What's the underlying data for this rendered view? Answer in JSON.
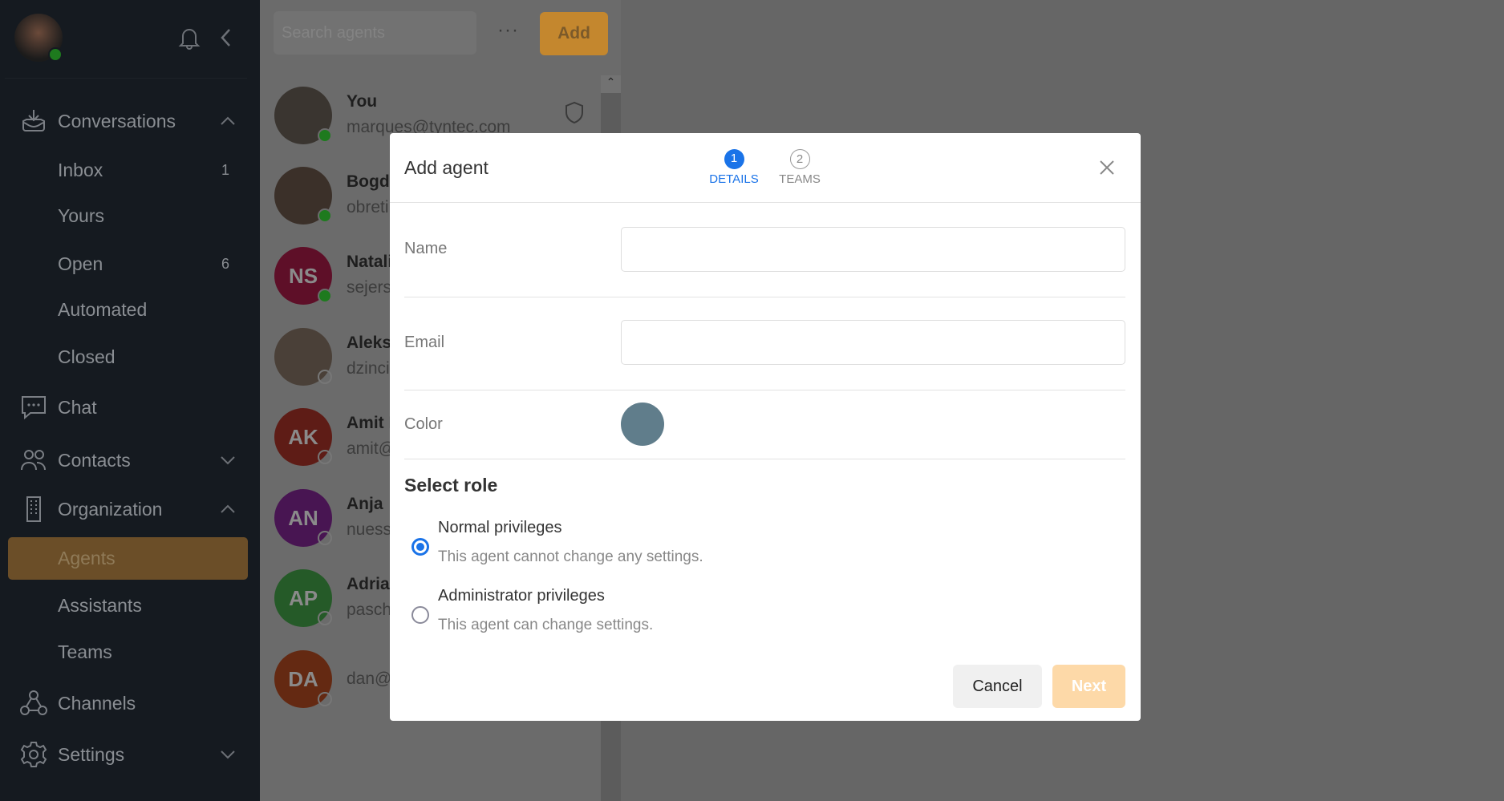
{
  "sidebar": {
    "items": [
      {
        "label": "Conversations",
        "icon": "inbox-download-icon",
        "chevron": "up"
      },
      {
        "label": "Inbox",
        "count": "1"
      },
      {
        "label": "Yours"
      },
      {
        "label": "Open",
        "count": "6"
      },
      {
        "label": "Automated"
      },
      {
        "label": "Closed"
      },
      {
        "label": "Chat",
        "icon": "chat-bubble-icon"
      },
      {
        "label": "Contacts",
        "icon": "people-icon",
        "chevron": "down"
      },
      {
        "label": "Organization",
        "icon": "building-icon",
        "chevron": "up"
      },
      {
        "label": "Agents",
        "active": true
      },
      {
        "label": "Assistants"
      },
      {
        "label": "Teams"
      },
      {
        "label": "Channels",
        "icon": "channels-icon"
      },
      {
        "label": "Settings",
        "icon": "gear-icon",
        "chevron": "down"
      }
    ]
  },
  "agents_panel": {
    "search_placeholder": "Search agents",
    "more_label": "···",
    "add_label": "Add",
    "rows": [
      {
        "name": "You",
        "email": "marques@tyntec.com",
        "initials": "",
        "color": "#3a3530",
        "online": true
      },
      {
        "name": "Bogda",
        "email": "obreti",
        "initials": "",
        "color": "#3b3029",
        "online": true
      },
      {
        "name": "Natali",
        "email": "sejers",
        "initials": "NS",
        "color": "#5e0f28",
        "online": true
      },
      {
        "name": "Aleks",
        "email": "dzinci",
        "initials": "",
        "color": "#4a4038",
        "online": false
      },
      {
        "name": "Amit I",
        "email": "amit@",
        "initials": "AK",
        "color": "#5e1c16",
        "online": false
      },
      {
        "name": "Anja",
        "email": "nuess",
        "initials": "AN",
        "color": "#481552",
        "online": false
      },
      {
        "name": "Adrian",
        "email": "pasch",
        "initials": "AP",
        "color": "#255a28",
        "online": false
      },
      {
        "name": "",
        "email": "dan@",
        "initials": "DA",
        "color": "#642912",
        "online": false
      }
    ]
  },
  "modal": {
    "title": "Add agent",
    "steps": [
      {
        "num": "1",
        "label": "DETAILS",
        "active": true
      },
      {
        "num": "2",
        "label": "TEAMS",
        "active": false
      }
    ],
    "name_label": "Name",
    "name_value": "",
    "email_label": "Email",
    "email_value": "",
    "color_label": "Color",
    "color_value": "#607d8b",
    "role_heading": "Select role",
    "roles": [
      {
        "title": "Normal privileges",
        "desc": "This agent cannot change any settings.",
        "selected": true
      },
      {
        "title": "Administrator privileges",
        "desc": "This agent can change settings.",
        "selected": false
      }
    ],
    "cancel_label": "Cancel",
    "next_label": "Next"
  },
  "colors": {
    "accent": "#1a73e8",
    "brand": "#f0a030",
    "next_disabled": "#fdd9a8"
  }
}
